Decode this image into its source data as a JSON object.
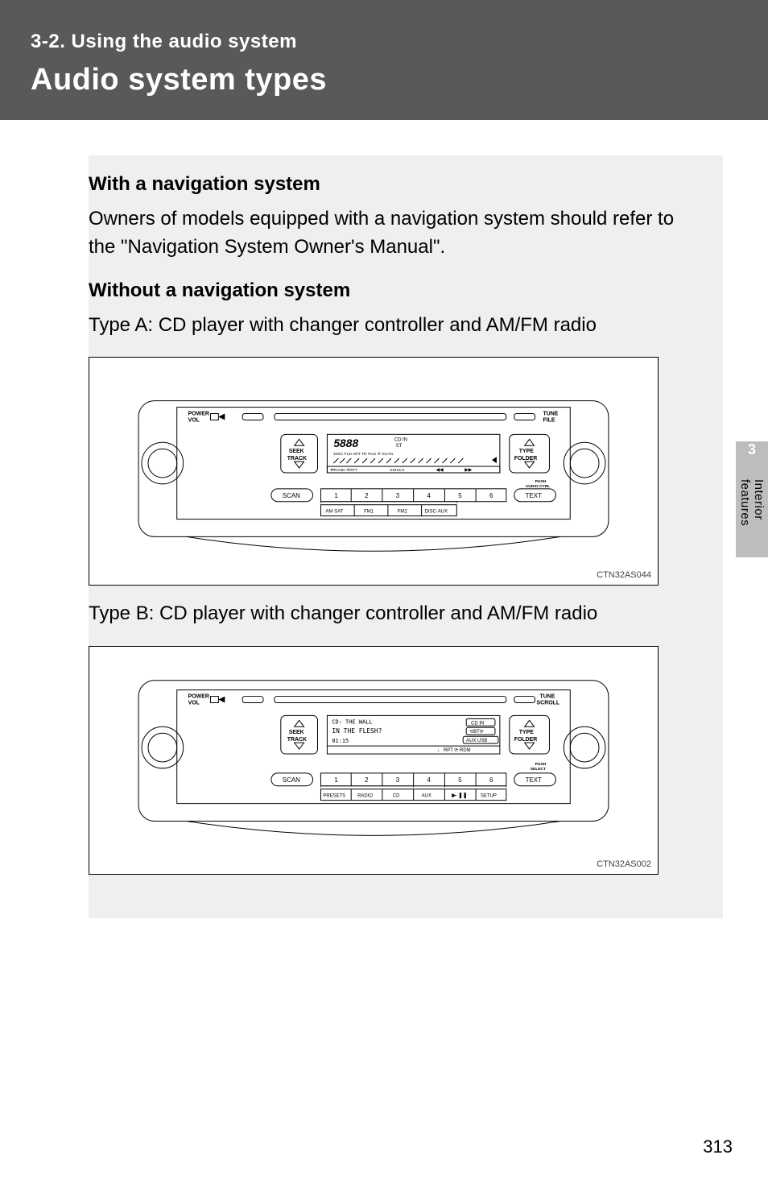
{
  "banner": {
    "section": "3-2. Using the audio system",
    "title": "Audio system types"
  },
  "content": {
    "h_with_nav": "With a navigation system",
    "p_with_nav": "Owners of models equipped with a navigation system should refer to the \"Navigation System Owner's Manual\".",
    "h_without_nav": "Without a navigation system",
    "p_type_a": "Type A: CD player with changer controller and AM/FM radio",
    "p_type_b": "Type B: CD player with changer controller and AM/FM radio"
  },
  "diagram_a": {
    "code": "CTN32AS044",
    "labels": {
      "power_vol": "POWER\nVOL",
      "tune_file": "TUNE\nFILE",
      "seek_track": "SEEK\nTRACK",
      "type_folder": "TYPE\nFOLDER",
      "scan": "SCAN",
      "text": "TEXT",
      "push_audio_ctrl": "PUSH\nAUDIO CTRL",
      "presets": [
        "1",
        "2",
        "3",
        "4",
        "5",
        "6"
      ],
      "sub_row": [
        "AM·SAT",
        "FM1",
        "FM2",
        "DISC·AUX"
      ],
      "display_main": "5888",
      "display_icons": "CD IN  ST",
      "display_row": "DISC  FLD  ART  TR  FILE   ⟳ SCAN",
      "display_bottom": [
        "⇄ RAND",
        "⟲ RPT",
        "∨ DISC ∧",
        "◀◀",
        "▶▶"
      ]
    }
  },
  "diagram_b": {
    "code": "CTN32AS002",
    "labels": {
      "power_vol": "POWER\nVOL",
      "tune_scroll": "TUNE\nSCROLL",
      "seek_track": "SEEK\nTRACK",
      "type_folder": "TYPE\nFOLDER",
      "scan": "SCAN",
      "text": "TEXT",
      "push_select": "PUSH\nSELECT",
      "presets": [
        "1",
        "2",
        "3",
        "4",
        "5",
        "6"
      ],
      "sub_row": [
        "PRESETS",
        "RADIO",
        "CD",
        "AUX",
        "▶·❚❚",
        "SETUP"
      ],
      "display_line1": "CD: THE WALL",
      "display_line2": "IN THE FLESH?",
      "display_line3": "01:15",
      "display_badges": [
        "CD IN",
        "⟲ BT ⟳",
        "AUX USB"
      ],
      "display_bottom": [
        "♩ RPT",
        "⟳ RDM"
      ]
    }
  },
  "sidebar": {
    "chapter_number": "3",
    "chapter_label": "Interior features"
  },
  "page_number": "313"
}
